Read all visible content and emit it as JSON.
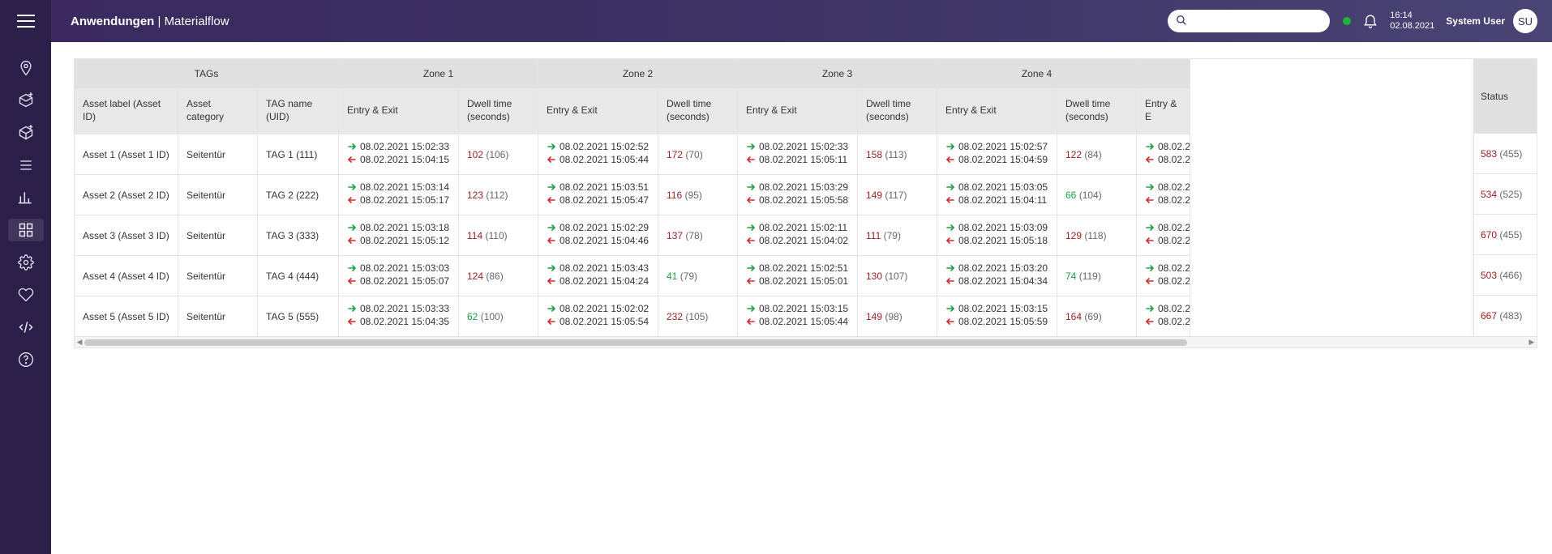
{
  "header": {
    "app": "Anwendungen",
    "page": "Materialflow",
    "time": "16:14",
    "date": "02.08.2021",
    "user_name": "System User",
    "user_initials": "SU"
  },
  "table": {
    "group_headers": [
      "TAGs",
      "Zone 1",
      "Zone 2",
      "Zone 3",
      "Zone 4",
      ""
    ],
    "sub_headers": {
      "asset_label": "Asset label (Asset ID)",
      "asset_category": "Asset category",
      "tag_name": "TAG name (UID)",
      "entry_exit": "Entry & Exit",
      "dwell": "Dwell time (seconds)",
      "status": "Status"
    },
    "rows": [
      {
        "asset_label": "Asset 1 (Asset 1 ID)",
        "asset_category": "Seitentür",
        "tag_name": "TAG 1 (111)",
        "zones": [
          {
            "entry": "08.02.2021 15:02:33",
            "exit": "08.02.2021 15:04:15",
            "dwell": "102",
            "dwell_p": "106"
          },
          {
            "entry": "08.02.2021 15:02:52",
            "exit": "08.02.2021 15:05:44",
            "dwell": "172",
            "dwell_p": "70"
          },
          {
            "entry": "08.02.2021 15:02:33",
            "exit": "08.02.2021 15:05:11",
            "dwell": "158",
            "dwell_p": "113"
          },
          {
            "entry": "08.02.2021 15:02:57",
            "exit": "08.02.2021 15:04:59",
            "dwell": "122",
            "dwell_p": "84"
          },
          {
            "entry": "08.02.2",
            "exit": "08.02.2"
          }
        ],
        "status": "583",
        "status_p": "455"
      },
      {
        "asset_label": "Asset 2 (Asset 2 ID)",
        "asset_category": "Seitentür",
        "tag_name": "TAG 2 (222)",
        "zones": [
          {
            "entry": "08.02.2021 15:03:14",
            "exit": "08.02.2021 15:05:17",
            "dwell": "123",
            "dwell_p": "112"
          },
          {
            "entry": "08.02.2021 15:03:51",
            "exit": "08.02.2021 15:05:47",
            "dwell": "116",
            "dwell_p": "95"
          },
          {
            "entry": "08.02.2021 15:03:29",
            "exit": "08.02.2021 15:05:58",
            "dwell": "149",
            "dwell_p": "117"
          },
          {
            "entry": "08.02.2021 15:03:05",
            "exit": "08.02.2021 15:04:11",
            "dwell": "66",
            "dwell_p": "104"
          },
          {
            "entry": "08.02.2",
            "exit": "08.02.2"
          }
        ],
        "status": "534",
        "status_p": "525"
      },
      {
        "asset_label": "Asset 3 (Asset 3 ID)",
        "asset_category": "Seitentür",
        "tag_name": "TAG 3 (333)",
        "zones": [
          {
            "entry": "08.02.2021 15:03:18",
            "exit": "08.02.2021 15:05:12",
            "dwell": "114",
            "dwell_p": "110"
          },
          {
            "entry": "08.02.2021 15:02:29",
            "exit": "08.02.2021 15:04:46",
            "dwell": "137",
            "dwell_p": "78"
          },
          {
            "entry": "08.02.2021 15:02:11",
            "exit": "08.02.2021 15:04:02",
            "dwell": "111",
            "dwell_p": "79"
          },
          {
            "entry": "08.02.2021 15:03:09",
            "exit": "08.02.2021 15:05:18",
            "dwell": "129",
            "dwell_p": "118"
          },
          {
            "entry": "08.02.2",
            "exit": "08.02.2"
          }
        ],
        "status": "670",
        "status_p": "455"
      },
      {
        "asset_label": "Asset 4 (Asset 4 ID)",
        "asset_category": "Seitentür",
        "tag_name": "TAG 4 (444)",
        "zones": [
          {
            "entry": "08.02.2021 15:03:03",
            "exit": "08.02.2021 15:05:07",
            "dwell": "124",
            "dwell_p": "86"
          },
          {
            "entry": "08.02.2021 15:03:43",
            "exit": "08.02.2021 15:04:24",
            "dwell": "41",
            "dwell_p": "79"
          },
          {
            "entry": "08.02.2021 15:02:51",
            "exit": "08.02.2021 15:05:01",
            "dwell": "130",
            "dwell_p": "107"
          },
          {
            "entry": "08.02.2021 15:03:20",
            "exit": "08.02.2021 15:04:34",
            "dwell": "74",
            "dwell_p": "119"
          },
          {
            "entry": "08.02.2",
            "exit": "08.02.2"
          }
        ],
        "status": "503",
        "status_p": "466"
      },
      {
        "asset_label": "Asset 5 (Asset 5 ID)",
        "asset_category": "Seitentür",
        "tag_name": "TAG 5 (555)",
        "zones": [
          {
            "entry": "08.02.2021 15:03:33",
            "exit": "08.02.2021 15:04:35",
            "dwell": "62",
            "dwell_p": "100"
          },
          {
            "entry": "08.02.2021 15:02:02",
            "exit": "08.02.2021 15:05:54",
            "dwell": "232",
            "dwell_p": "105"
          },
          {
            "entry": "08.02.2021 15:03:15",
            "exit": "08.02.2021 15:05:44",
            "dwell": "149",
            "dwell_p": "98"
          },
          {
            "entry": "08.02.2021 15:03:15",
            "exit": "08.02.2021 15:05:59",
            "dwell": "164",
            "dwell_p": "69"
          },
          {
            "entry": "08.02.2",
            "exit": "08.02.2"
          }
        ],
        "status": "667",
        "status_p": "483"
      }
    ]
  }
}
